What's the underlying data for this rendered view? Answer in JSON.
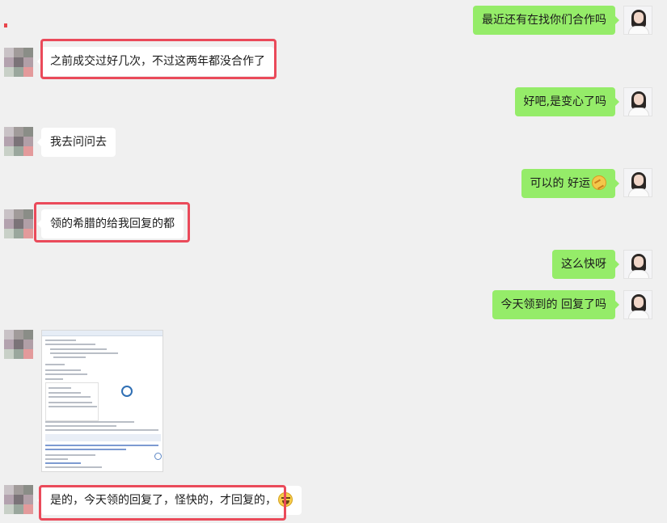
{
  "messages": [
    {
      "side": "right",
      "text": "最近还有在找你们合作吗"
    },
    {
      "side": "left",
      "text": "之前成交过好几次，不过这两年都没合作了",
      "highlighted": true
    },
    {
      "side": "right",
      "text": "好吧,是变心了吗"
    },
    {
      "side": "left",
      "text": "我去问问去"
    },
    {
      "side": "right",
      "text": "可以的 好运",
      "emoji": "luck-emoji"
    },
    {
      "side": "left",
      "text": "领的希腊的给我回复的都",
      "highlighted": true
    },
    {
      "side": "right",
      "text": "这么快呀"
    },
    {
      "side": "right",
      "text": "今天领到的 回复了吗"
    },
    {
      "side": "left",
      "type": "image",
      "content": "email-screenshot-thumbnail"
    },
    {
      "side": "left",
      "text": "是的，今天领的回复了，怪快的，才回复的，",
      "emoji": "laugh-emoji",
      "highlighted": true
    }
  ],
  "colors": {
    "background": "#f0f0f0",
    "sent_bubble": "#95ec69",
    "received_bubble": "#ffffff",
    "highlight": "#ea4a5a"
  },
  "icons": {
    "sent_avatar": "woman-portrait-avatar",
    "received_avatar": "pixelated-mosaic-avatar"
  }
}
